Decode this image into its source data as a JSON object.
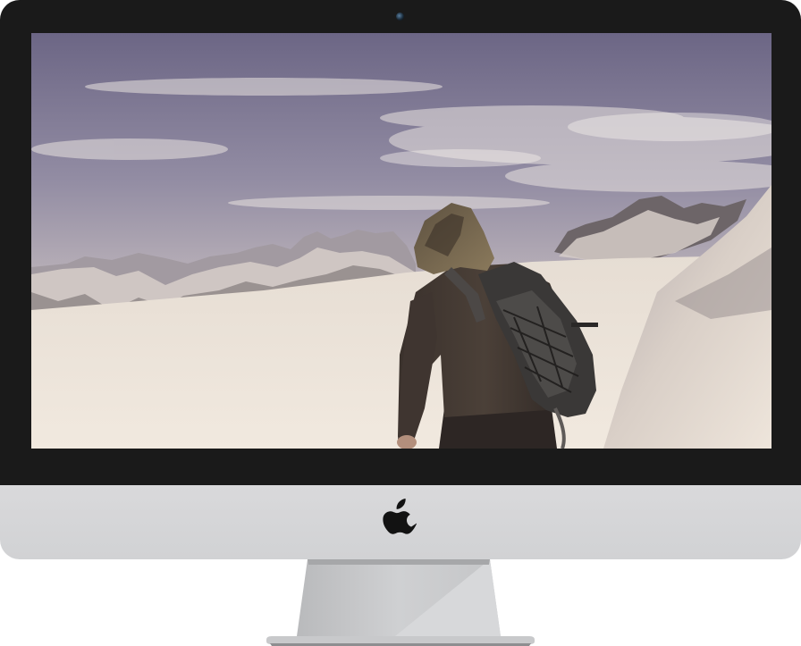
{
  "device": {
    "bezel_color": "#1a1a1a",
    "chin_color": "#d4d5d7",
    "stand_color": "#c2c3c5",
    "logo_icon": "apple-logo-icon",
    "camera_icon": "camera-icon"
  },
  "screen": {
    "wallpaper": "hiker-snowy-mountains-photo",
    "sky_color": "#7f7a92",
    "snow_color": "#ece3d9"
  }
}
